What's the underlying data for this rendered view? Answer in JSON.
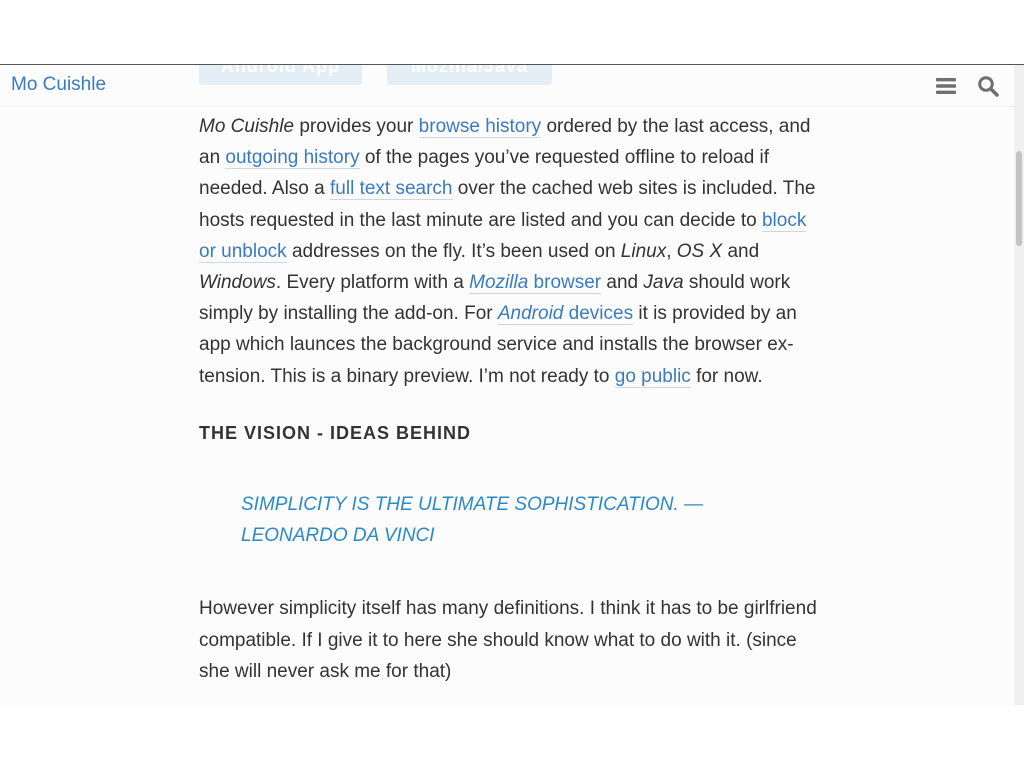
{
  "top_buttons": {
    "android_label": "Android App",
    "mozilla_label": "Mozilla/Java"
  },
  "header": {
    "site_title": "Mo Cuishle",
    "menu_icon": "menu-icon",
    "search_icon": "search-icon"
  },
  "colors": {
    "link": "#3a7bbf",
    "quote": "#2b8ac6",
    "text": "#333333"
  },
  "intro": {
    "brand": "Mo Cuishle",
    "t1": " provides your ",
    "link_browse_history": "browse history",
    "t2": " ordered by the last access, and an ",
    "link_outgoing_history": "outgoing history",
    "t3": " of the pages you’ve requested offline to reload if needed. Also a ",
    "link_full_text_search": "full text search",
    "t4": " over the cached web sites is included. The hosts requested in the last minute are listed and you can decide to ",
    "link_block_unblock": "block or unblock",
    "t5": " addresses on the fly. It’s been used on ",
    "linux": "Linux",
    "t6": ", ",
    "osx": "OS X",
    "t7": " and ",
    "windows": "Windows",
    "t8": ". Every platform with a ",
    "link_mozilla": "Mozilla",
    "link_browser": " browser",
    "t9": " and ",
    "java": "Java",
    "t10": " should work simply by installing the add-on. For ",
    "link_android": "Android",
    "link_devices": " devices",
    "t11": " it is provided by an app which launces the background service and installs the browser ex­tension. This is a binary preview. I’m not ready to ",
    "link_go_public": "go public",
    "t12": " for now."
  },
  "vision": {
    "heading": "THE VISION - IDEAS BEHIND",
    "quote": "SIMPLICITY IS THE ULTIMATE SOPHISTICATION. — LEONARDO DA VINCI",
    "paragraph": "However simplicity itself has many definitions. I think it has to be girl­friend compatible. If I give it to here she should know what to do with it. (since she will never ask me for that)"
  }
}
